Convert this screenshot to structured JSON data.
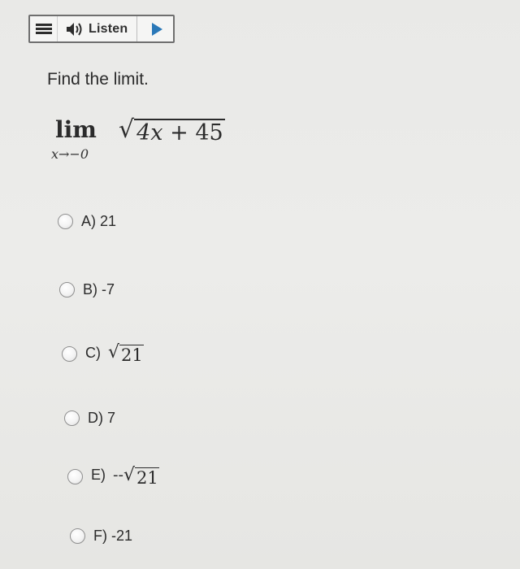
{
  "toolbar": {
    "menu_icon": "hamburger-menu-icon",
    "speaker_icon": "speaker-icon",
    "listen_label": "Listen",
    "play_icon": "play-icon"
  },
  "question": {
    "prompt": "Find the limit.",
    "lim_word": "lim",
    "lim_subscript": "x→−0",
    "radicand_var": "4x",
    "radicand_rest": " + 45"
  },
  "options": [
    {
      "letter": "A)",
      "value": "21"
    },
    {
      "letter": "B)",
      "value": "-7"
    },
    {
      "letter": "C)",
      "radicand": "21"
    },
    {
      "letter": "D)",
      "value": "7"
    },
    {
      "letter": "E)",
      "prefix": "--",
      "radicand": "21"
    },
    {
      "letter": "F)",
      "value": "-21"
    }
  ],
  "colors": {
    "accent_play": "#2a78b8",
    "background": "#ebebe9",
    "text": "#2b2b2b"
  }
}
